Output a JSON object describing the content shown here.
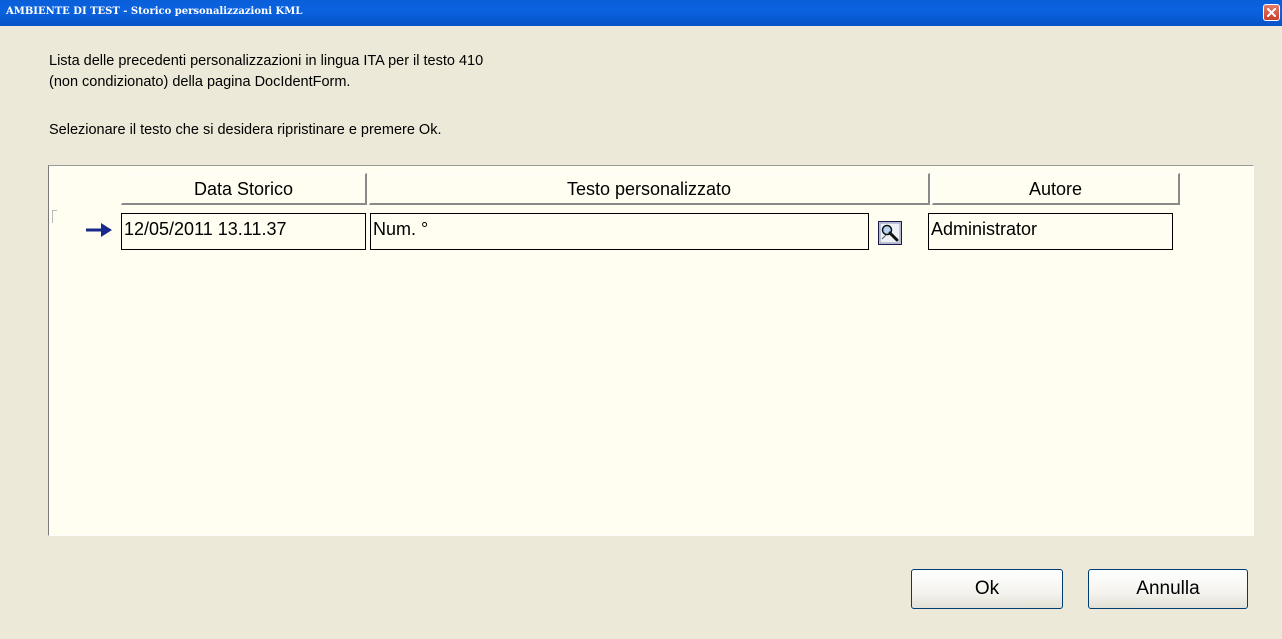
{
  "window": {
    "title": "AMBIENTE DI TEST - Storico personalizzazioni KML"
  },
  "intro": {
    "line1": "Lista delle precedenti personalizzazioni in lingua ITA per il testo 410",
    "line2": "(non condizionato) della pagina DocIdentForm."
  },
  "instruction": "Selezionare il testo che si desidera ripristinare e premere Ok.",
  "grid": {
    "columns": [
      "Data Storico",
      "Testo personalizzato",
      "Autore"
    ],
    "rows": [
      {
        "data_storico": "12/05/2011 13.11.37",
        "testo_personalizzato": "Num. °",
        "autore": "Administrator"
      }
    ]
  },
  "buttons": {
    "ok": "Ok",
    "cancel": "Annulla"
  },
  "icons": {
    "close": "close-icon",
    "current_row": "arrow-right-icon",
    "edit_text": "zoom-edit-icon"
  },
  "colors": {
    "titlebar": "#0A5FD8",
    "window_bg": "#ECE9D8",
    "grid_bg": "#FFFEF1",
    "arrow": "#1A2A8C",
    "close_btn": "#D2533B"
  }
}
